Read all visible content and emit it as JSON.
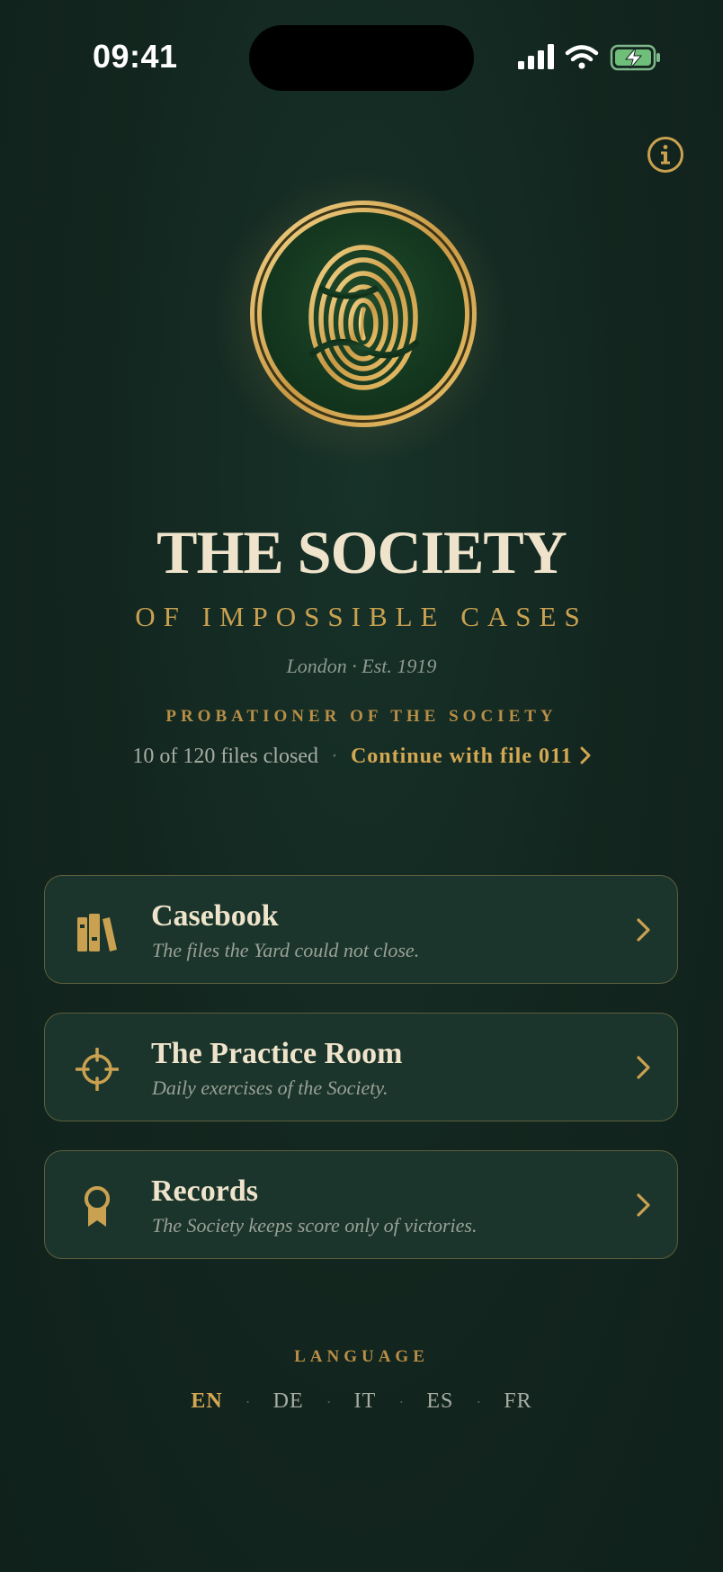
{
  "status_bar": {
    "time": "09:41"
  },
  "header": {
    "title": "THE SOCIETY",
    "subtitle": "OF IMPOSSIBLE CASES",
    "est": "London · Est. 1919",
    "rank": "PROBATIONER OF THE SOCIETY"
  },
  "progress": {
    "files_closed": "10 of 120 files closed",
    "separator": "·",
    "continue_label": "Continue with file 011"
  },
  "menu": [
    {
      "title": "Casebook",
      "subtitle": "The files the Yard could not close.",
      "icon": "books-icon"
    },
    {
      "title": "The Practice Room",
      "subtitle": "Daily exercises of the Society.",
      "icon": "crosshair-icon"
    },
    {
      "title": "Records",
      "subtitle": "The Society keeps score only of victories.",
      "icon": "award-ribbon-icon"
    }
  ],
  "language": {
    "label": "LANGUAGE",
    "options": [
      "EN",
      "DE",
      "IT",
      "ES",
      "FR"
    ],
    "selected": "EN",
    "separator": "·"
  },
  "colors": {
    "background": "#12251e",
    "gold": "#d4a853",
    "card_bg": "#1b352c",
    "card_border": "#5e5f3c",
    "cream": "#efe4cb"
  }
}
